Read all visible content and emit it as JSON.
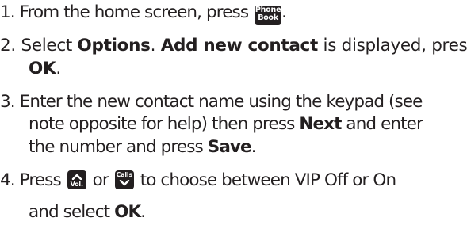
{
  "steps": [
    {
      "num": "1.",
      "lines": [
        {
          "before": "From the home screen, press",
          "key_label_top": "Phone",
          "key_label_bottom": "Book",
          "after": "."
        }
      ]
    },
    {
      "num": "2.",
      "lines": [
        {
          "t1": "Select ",
          "b1": "Options",
          "t2": ". ",
          "b2": "Add new contact",
          "t3": " is displayed, press"
        },
        {
          "b1": "OK",
          "t1": "."
        }
      ]
    },
    {
      "num": "3.",
      "lines": [
        {
          "t1": "Enter the new contact name using the keypad (see"
        },
        {
          "t1": "note opposite for help) then press ",
          "b1": "Next",
          "t2": " and enter"
        },
        {
          "t1": "the number and press ",
          "b1": "Save",
          "t2": "."
        }
      ]
    },
    {
      "num": "4.",
      "lines": [
        {
          "t1": "Press",
          "key1_label": "Vol.",
          "t2": "or",
          "key2_label": "Calls",
          "t3": "to choose between VIP Off or On"
        },
        {
          "t1": "and select ",
          "b1": "OK",
          "t2": "."
        }
      ]
    }
  ],
  "icons": {
    "phonebook_key": "phonebook-key-icon",
    "vol_up_key": "vol-up-key-icon",
    "calls_down_key": "calls-down-key-icon"
  },
  "colors": {
    "text": "#231f20",
    "key_background": "#231f20",
    "key_text": "#ffffff"
  }
}
